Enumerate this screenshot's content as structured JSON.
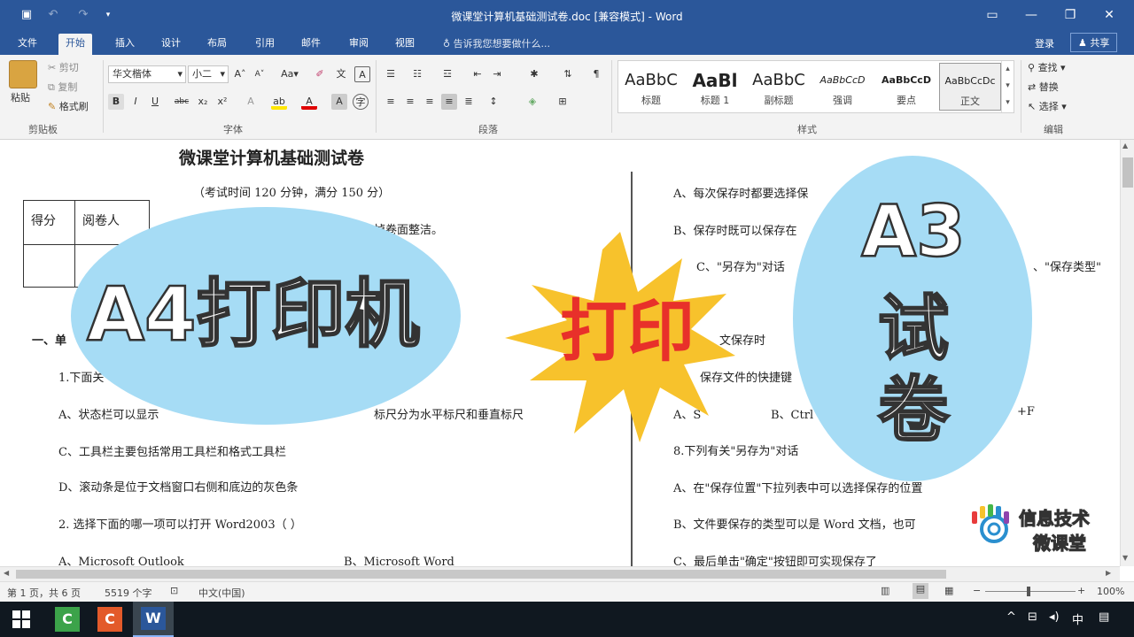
{
  "window": {
    "title": "微课堂计算机基础测试卷.doc [兼容模式] - Word",
    "qat": [
      "save-icon",
      "undo-icon",
      "redo-icon",
      "customize-icon"
    ],
    "controls": [
      "ribbon-options-icon",
      "minimize-icon",
      "restore-icon",
      "close-icon"
    ]
  },
  "tabs": [
    "文件",
    "开始",
    "插入",
    "设计",
    "布局",
    "引用",
    "邮件",
    "审阅",
    "视图"
  ],
  "active_tab": "开始",
  "tell_me": "告诉我您想要做什么...",
  "account": {
    "signin": "登录",
    "share": "共享"
  },
  "ribbon": {
    "clipboard": {
      "paste": "粘贴",
      "cut": "剪切",
      "copy": "复制",
      "format_painter": "格式刷",
      "label": "剪贴板"
    },
    "font": {
      "name": "华文楷体",
      "size": "小二",
      "label": "字体",
      "aa": "Aa"
    },
    "paragraph": {
      "label": "段落"
    },
    "styles": {
      "label": "样式",
      "items": [
        {
          "sample": "AaBbC",
          "name": "标题"
        },
        {
          "sample": "AaBl",
          "name": "标题 1"
        },
        {
          "sample": "AaBbC",
          "name": "副标题"
        },
        {
          "sample": "AaBbCcD",
          "name": "强调"
        },
        {
          "sample": "AaBbCcD",
          "name": "要点"
        },
        {
          "sample": "AaBbCcDc",
          "name": "正文"
        }
      ]
    },
    "editing": {
      "find": "查找",
      "replace": "替换",
      "select": "选择",
      "label": "编辑"
    }
  },
  "document": {
    "title": "微课堂计算机基础测试卷",
    "subtitle": "（考试时间 120 分钟，满分 150 分）",
    "score_table": {
      "col1": "得分",
      "col2": "阅卷人"
    },
    "left_lines": [
      "掉卷面整洁。",
      "一、单",
      "1.下面关",
      "A、状态栏可以显示",
      "标尺分为水平标尺和垂直标尺",
      "C、工具栏主要包括常用工具栏和格式工具栏",
      "D、滚动条是位于文档窗口右侧和底边的灰色条",
      "2. 选择下面的哪一项可以打开 Word2003（    ）",
      "A、Microsoft  Outlook",
      "B、Microsoft  Word"
    ],
    "right_lines": [
      "A、每次保存时都要选择保",
      "B、保存时既可以保存在",
      "C、\"另存为\"对话",
      "、\"保存类型\"",
      "文保存时",
      "保存文件的快捷键",
      "A、S",
      "B、Ctrl",
      "+F",
      "8.下列有关\"另存为\"对话",
      "A、在\"保存位置\"下拉列表中可以选择保存的位置",
      "B、文件要保存的类型可以是 Word 文档，也可",
      "C、最后单击\"确定\"按钮即可实现保存了"
    ]
  },
  "overlays": {
    "left": "A4打印机",
    "center": "打印",
    "right_lines": [
      "A3",
      "试",
      "卷"
    ],
    "logo_lines": [
      "信息技术",
      "微课堂"
    ]
  },
  "status": {
    "page": "第 1 页，共 6 页",
    "words": "5519 个字",
    "lang": "中文(中国)",
    "zoom": "100%"
  },
  "taskbar": {
    "apps": [
      "windows-start-icon",
      "camtasia-green-icon",
      "camtasia-red-icon",
      "word-icon"
    ],
    "tray": [
      "^",
      "中"
    ]
  },
  "colors": {
    "word_blue": "#2b579a",
    "bubble_blue": "#a6dcf5",
    "star_yellow": "#f7c22c",
    "print_red": "#e8302a"
  }
}
